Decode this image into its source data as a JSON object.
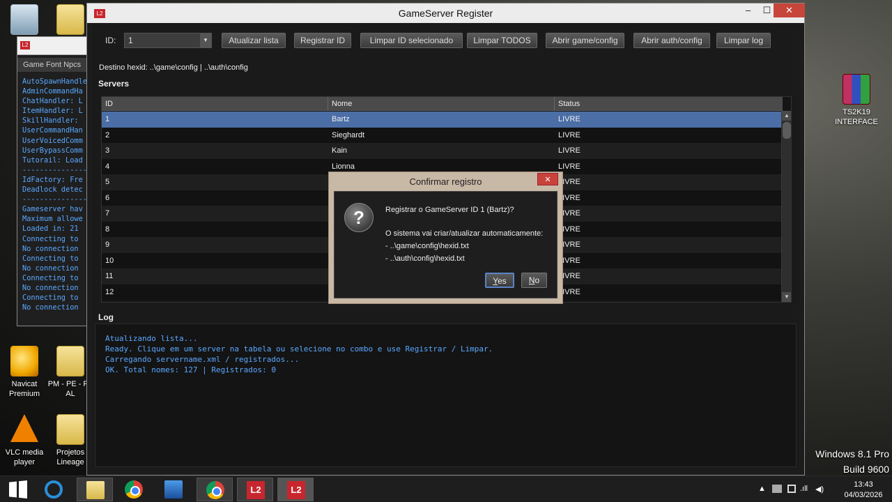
{
  "desktop": {
    "icons": [
      {
        "label": "",
        "glyph": "recycle-bin"
      },
      {
        "label": "",
        "glyph": "folder"
      },
      {
        "label": "Navicat Premium",
        "glyph": "navicat"
      },
      {
        "label": "PM - PE - P -AL",
        "glyph": "folder"
      },
      {
        "label": "VLC media player",
        "glyph": "vlc"
      },
      {
        "label": "Projetos Lineage",
        "glyph": "folder"
      },
      {
        "label": "TS2K19 INTERFACE",
        "glyph": "winrar"
      }
    ],
    "watermark": {
      "line1": "Windows 8.1 Pro",
      "line2": "Build 9600"
    }
  },
  "console": {
    "menu": "Game  Font  Npcs",
    "lines": [
      "AutoSpawnHandle",
      "AdminCommandHa",
      "ChatHandler: L",
      "ItemHandler: L",
      "SkillHandler: ",
      "UserCommandHan",
      "UserVoicedComm",
      "UserBypassComm",
      "Tutorail: Load",
      "---------------",
      "IdFactory: Fre",
      "Deadlock detec",
      "---------------",
      "Gameserver hav",
      "Maximum allowe",
      "Loaded in: 21 ",
      "Connecting to ",
      "No connection ",
      "Connecting to ",
      "No connection ",
      "Connecting to ",
      "No connection ",
      "Connecting to ",
      "No connection "
    ]
  },
  "window": {
    "icon_text": "L2",
    "title": "GameServer Register",
    "min": "–",
    "max": "☐",
    "close": "✕"
  },
  "toolbar": {
    "id_label": "ID:",
    "combo_value": "1",
    "combo_arrow": "▼",
    "buttons": {
      "refresh": "Atualizar lista",
      "register": "Registrar ID",
      "clear_selected": "Limpar ID selecionado",
      "clear_all": "Limpar TODOS",
      "open_game": "Abrir game/config",
      "open_auth": "Abrir auth/config",
      "clear_log": "Limpar log"
    }
  },
  "destination": "Destino hexid: ..\\game\\config | ..\\auth\\config",
  "servers": {
    "heading": "Servers",
    "columns": [
      "ID",
      "Nome",
      "Status"
    ],
    "rows": [
      {
        "id": "1",
        "name": "Bartz",
        "status": "LIVRE",
        "selected": true
      },
      {
        "id": "2",
        "name": "Sieghardt",
        "status": "LIVRE"
      },
      {
        "id": "3",
        "name": "Kain",
        "status": "LIVRE"
      },
      {
        "id": "4",
        "name": "Lionna",
        "status": "LIVRE"
      },
      {
        "id": "5",
        "name": "",
        "status": "LIVRE"
      },
      {
        "id": "6",
        "name": "",
        "status": "LIVRE"
      },
      {
        "id": "7",
        "name": "",
        "status": "LIVRE"
      },
      {
        "id": "8",
        "name": "",
        "status": "LIVRE"
      },
      {
        "id": "9",
        "name": "",
        "status": "LIVRE"
      },
      {
        "id": "10",
        "name": "",
        "status": "LIVRE"
      },
      {
        "id": "11",
        "name": "",
        "status": "LIVRE"
      },
      {
        "id": "12",
        "name": "",
        "status": "LIVRE"
      }
    ]
  },
  "log": {
    "heading": "Log",
    "lines": [
      "Atualizando lista...",
      "Ready. Clique em um server na tabela ou selecione no combo e use Registrar / Limpar.",
      "Carregando servername.xml / registrados...",
      "OK. Total nomes: 127 | Registrados: 0"
    ]
  },
  "dialog": {
    "title": "Confirmar registro",
    "close": "✕",
    "icon": "?",
    "question": "Registrar o GameServer ID 1 (Bartz)?",
    "info": "O sistema vai criar/atualizar automaticamente:",
    "path1": "- ..\\game\\config\\hexid.txt",
    "path2": "- ..\\auth\\config\\hexid.txt",
    "yes_rest": "es",
    "yes_mnemonic": "Y",
    "no_rest": "o",
    "no_mnemonic": "N"
  },
  "taskbar": {
    "l2_label": "L2",
    "tray": {
      "arrow": "▲",
      "signal": ".ıll",
      "volume": "◀)"
    },
    "time": "13:43",
    "date": "04/03/2026"
  },
  "colors": {
    "accent_selected_row": "#4b6ea6",
    "log_text": "#5aa8ff",
    "close_button": "#c7453a"
  }
}
